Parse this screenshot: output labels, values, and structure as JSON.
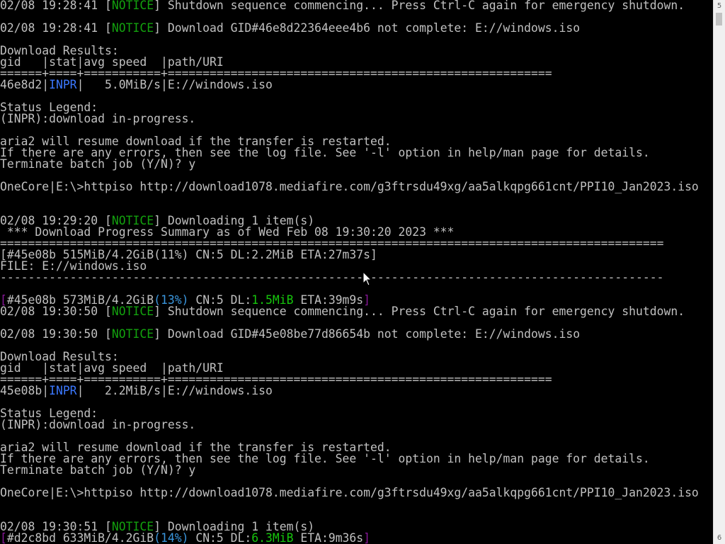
{
  "colors": {
    "default": "#c0c0c0",
    "notice": "#13a10e",
    "inpr": "#3b78ff",
    "progress_bracket": "#881798",
    "progress_pct": "#3a96dd",
    "dl_speed": "#16c60c"
  },
  "scrollbar": {
    "up_label": "5",
    "down_label": "6",
    "up_icon": "scroll-up-icon",
    "down_icon": "scroll-down-icon"
  },
  "lines": [
    [
      {
        "t": "02/08 19:28:41 ["
      },
      {
        "t": "NOTICE",
        "c": "notice"
      },
      {
        "t": "] Shutdown sequence commencing... Press Ctrl-C again for emergency shutdown."
      }
    ],
    [],
    [
      {
        "t": "02/08 19:28:41 ["
      },
      {
        "t": "NOTICE",
        "c": "notice"
      },
      {
        "t": "] Download GID#46e8d22364eee4b6 not complete: E://windows.iso"
      }
    ],
    [],
    [
      {
        "t": "Download Results:"
      }
    ],
    [
      {
        "t": "gid   |stat|avg speed  |path/URI"
      }
    ],
    [
      {
        "t": "======+====+===========+======================================================="
      }
    ],
    [
      {
        "t": "46e8d2|"
      },
      {
        "t": "INPR",
        "c": "inpr"
      },
      {
        "t": "|   5.0MiB/s|E://windows.iso"
      }
    ],
    [],
    [
      {
        "t": "Status Legend:"
      }
    ],
    [
      {
        "t": "(INPR):download in-progress."
      }
    ],
    [],
    [
      {
        "t": "aria2 will resume download if the transfer is restarted."
      }
    ],
    [
      {
        "t": "If there are any errors, then see the log file. See '-l' option in help/man page for details."
      }
    ],
    [
      {
        "t": "Terminate batch job (Y/N)? y"
      }
    ],
    [],
    [
      {
        "t": "OneCore|E:\\>httpiso http://download1078.mediafire.com/g3ftrsdu49xg/aa5alkqpg661cnt/PPI10_Jan2023.iso"
      }
    ],
    [],
    [],
    [
      {
        "t": "02/08 19:29:20 ["
      },
      {
        "t": "NOTICE",
        "c": "notice"
      },
      {
        "t": "] Downloading 1 item(s)"
      }
    ],
    [
      {
        "t": " *** Download Progress Summary as of Wed Feb 08 19:30:20 2023 ***"
      }
    ],
    [
      {
        "t": "==============================================================================================="
      }
    ],
    [
      {
        "t": "[#45e08b 515MiB/4.2GiB(11%) CN:5 DL:2.2MiB ETA:27m37s]"
      }
    ],
    [
      {
        "t": "FILE: E://windows.iso"
      }
    ],
    [
      {
        "t": "-----------------------------------------------------------------------------------------------"
      }
    ],
    [],
    [
      {
        "t": "[",
        "c": "progress_bracket"
      },
      {
        "t": "#45e08b 573MiB/4.2GiB"
      },
      {
        "t": "(13%)",
        "c": "progress_pct"
      },
      {
        "t": " CN:5 DL:"
      },
      {
        "t": "1.5MiB",
        "c": "dl_speed"
      },
      {
        "t": " ETA:39m9s"
      },
      {
        "t": "]",
        "c": "progress_bracket"
      }
    ],
    [
      {
        "t": "02/08 19:30:50 ["
      },
      {
        "t": "NOTICE",
        "c": "notice"
      },
      {
        "t": "] Shutdown sequence commencing... Press Ctrl-C again for emergency shutdown."
      }
    ],
    [],
    [
      {
        "t": "02/08 19:30:50 ["
      },
      {
        "t": "NOTICE",
        "c": "notice"
      },
      {
        "t": "] Download GID#45e08be77d86654b not complete: E://windows.iso"
      }
    ],
    [],
    [
      {
        "t": "Download Results:"
      }
    ],
    [
      {
        "t": "gid   |stat|avg speed  |path/URI"
      }
    ],
    [
      {
        "t": "======+====+===========+======================================================="
      }
    ],
    [
      {
        "t": "45e08b|"
      },
      {
        "t": "INPR",
        "c": "inpr"
      },
      {
        "t": "|   2.2MiB/s|E://windows.iso"
      }
    ],
    [],
    [
      {
        "t": "Status Legend:"
      }
    ],
    [
      {
        "t": "(INPR):download in-progress."
      }
    ],
    [],
    [
      {
        "t": "aria2 will resume download if the transfer is restarted."
      }
    ],
    [
      {
        "t": "If there are any errors, then see the log file. See '-l' option in help/man page for details."
      }
    ],
    [
      {
        "t": "Terminate batch job (Y/N)? y"
      }
    ],
    [],
    [
      {
        "t": "OneCore|E:\\>httpiso http://download1078.mediafire.com/g3ftrsdu49xg/aa5alkqpg661cnt/PPI10_Jan2023.iso"
      }
    ],
    [],
    [],
    [
      {
        "t": "02/08 19:30:51 ["
      },
      {
        "t": "NOTICE",
        "c": "notice"
      },
      {
        "t": "] Downloading 1 item(s)"
      }
    ],
    [
      {
        "t": "[",
        "c": "progress_bracket"
      },
      {
        "t": "#d2c8bd 633MiB/4.2GiB"
      },
      {
        "t": "(14%)",
        "c": "progress_pct"
      },
      {
        "t": " CN:5 DL:"
      },
      {
        "t": "6.3MiB",
        "c": "dl_speed"
      },
      {
        "t": " ETA:9m36s"
      },
      {
        "t": "]",
        "c": "progress_bracket"
      }
    ]
  ]
}
